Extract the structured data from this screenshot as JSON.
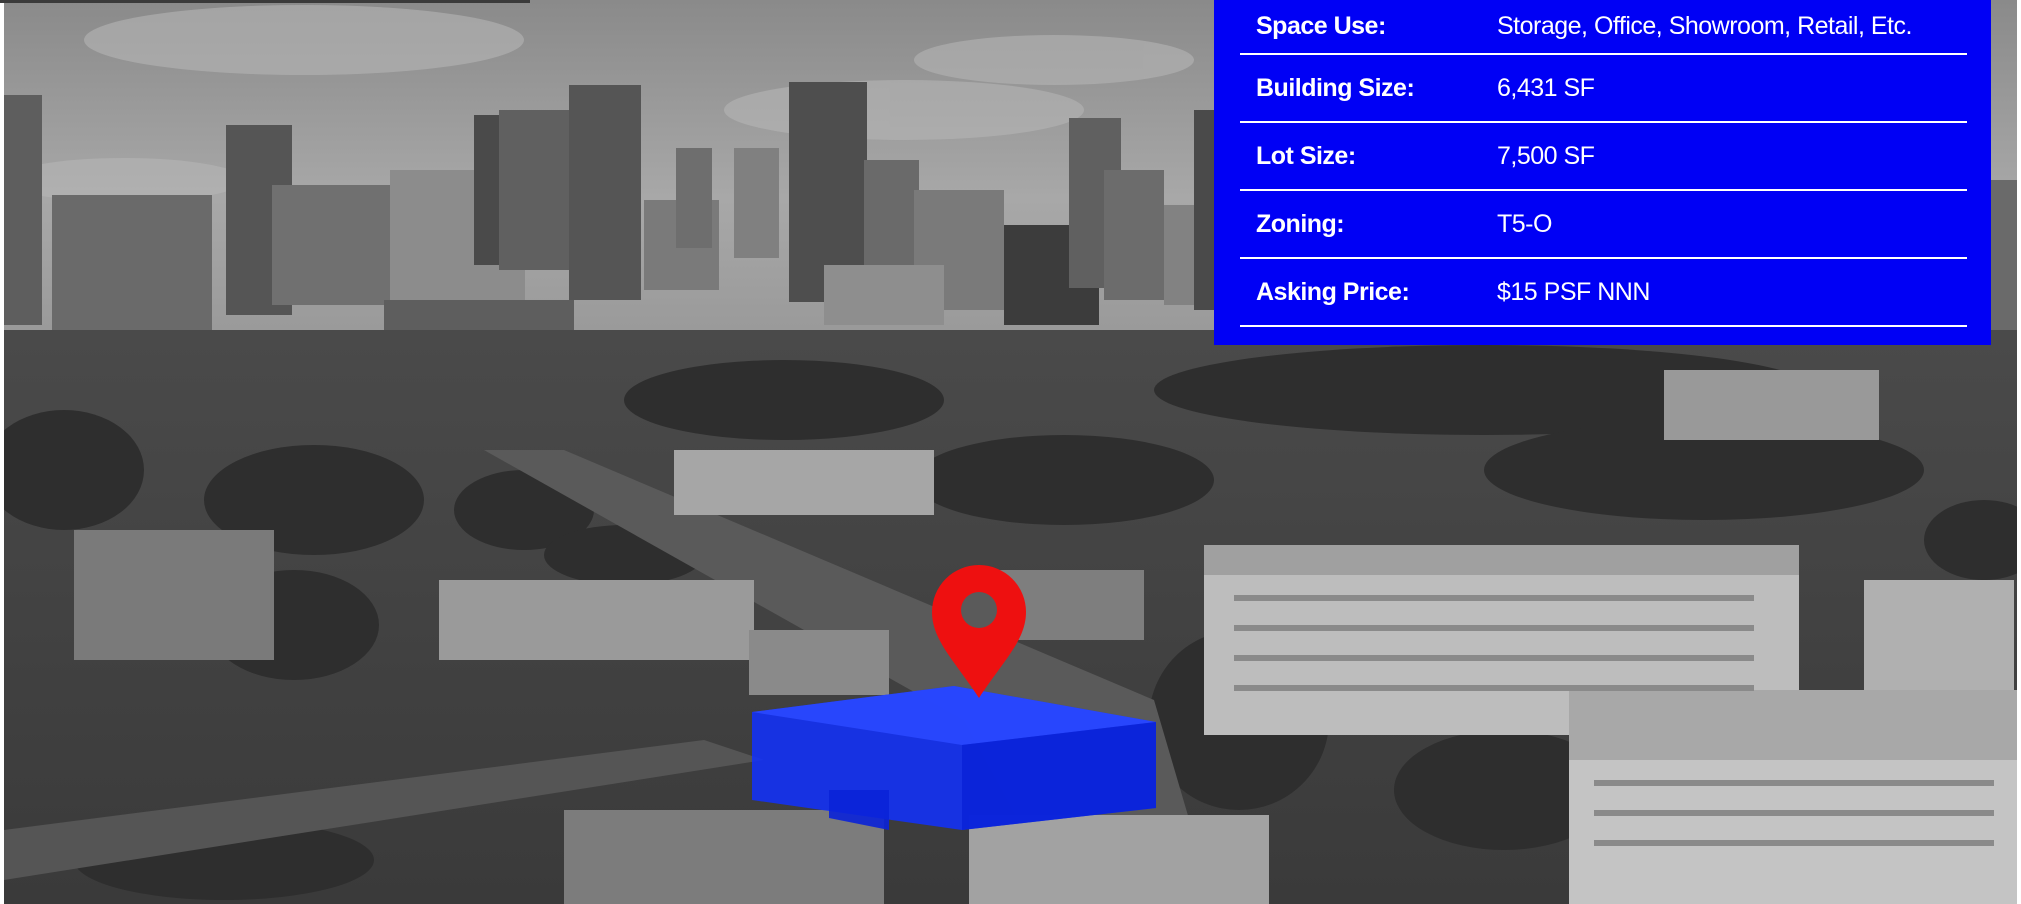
{
  "specs": {
    "rows": [
      {
        "label": "Space Use:",
        "value": "Storage, Office, Showroom, Retail, Etc."
      },
      {
        "label": "Building Size:",
        "value": "6,431 SF"
      },
      {
        "label": "Lot Size:",
        "value": "7,500 SF"
      },
      {
        "label": "Zoning:",
        "value": "T5-O"
      },
      {
        "label": "Asking Price:",
        "value": "$15 PSF NNN"
      }
    ]
  },
  "colors": {
    "panel_background": "#0000f5",
    "panel_text": "#ffffff",
    "building_highlight": "#1030ff",
    "location_pin": "#ee1010"
  },
  "icons": {
    "pin": "map-pin-icon"
  }
}
